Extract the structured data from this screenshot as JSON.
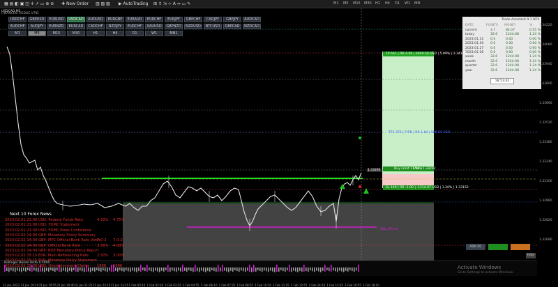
{
  "toolbar": {
    "new_order": "New Order",
    "auto_trading": "AutoTrading",
    "timeframes": [
      "M1",
      "M5",
      "M15",
      "M30",
      "H1",
      "H4",
      "D1",
      "W1",
      "MN"
    ]
  },
  "chart": {
    "symbol_title": "USDCAD,M5",
    "subtitle": "FINANCIAL HEDGE VTID",
    "symbols_row1": [
      "USDCHF",
      "GBPUSD",
      "EURUSD",
      "USDCAD",
      "AUDUSD",
      "EURGBP",
      "EURAUD",
      "EURCHF",
      "EURJPY",
      "GBPCHF",
      "CADJPY",
      "GBPJPY",
      "AUDCAD"
    ],
    "symbols_row2": [
      "AUDCHF",
      "AUDJPY",
      "EURNZD",
      "EURCAD",
      "CADCHF",
      "NZDJPY",
      "EURCHF",
      "XAUUSD",
      "GBPNZD",
      "NZDUSD",
      "BTCUSD",
      "GBPCAD",
      "NZDCAD"
    ],
    "periods": [
      "M1",
      "M5",
      "M15",
      "M30",
      "H1",
      "H4",
      "D1",
      "W1",
      "MN1"
    ],
    "active_symbol": "USDCAD",
    "active_period": "M5",
    "price_axis": [
      "1.34220",
      "1.34080",
      "1.33940",
      "1.33800",
      "1.33660",
      "1.33520",
      "1.33380",
      "1.33240",
      "1.33100",
      "1.32960",
      "1.32820",
      "1.32680"
    ],
    "time_axis": [
      "31 Jan 2023",
      "31 Jan 19:10",
      "31 Jan 19:55",
      "31 Jan 20:40",
      "31 Jan 21:25",
      "31 Jan 22:10",
      "31 Jan 23:25",
      "1 Feb 00:10",
      "1 Feb 02:10",
      "1 Feb 03:25",
      "1 Feb 04:55",
      "1 Feb 06:10",
      "1 Feb 07:25",
      "1 Feb 08:55",
      "1 Feb 10:10",
      "1 Feb 11:25",
      "1 Feb 12:55",
      "1 Feb 14:10",
      "1 Feb 15:25",
      "1 Feb 16:55",
      "1 Feb 18:10"
    ],
    "tp_label": "TP 641 | RR 4.99 | 6059.50 USD | 5.99% | 1.34133",
    "tp1_label": "TP1 373 | P RR | RR 1.84 | 589.59 USD",
    "entry_label": "Buy Limit 11.56 | 1.33292",
    "place_label": "Place",
    "sl_label": "SL 140 | RR -1.00 | -1214.07 USD | 1.20% | 1.33152",
    "sell_label": "SELL/PEvolt",
    "adr_label": "ADR D1",
    "bottom_buttons": [
      "Hide"
    ],
    "indicator": "Bollinger Bands Histo 0.5000",
    "watermark_title": "Activate Windows",
    "watermark_sub": "Go to Settings to activate Windows.",
    "price_tag": "1.33292"
  },
  "assistant": {
    "title": "Trade Assistant 9.1 NT4",
    "headers": [
      "DATE",
      "POINTS",
      "MONEY",
      "%"
    ],
    "rows": [
      [
        "current",
        "3.7",
        "84.07",
        "0.55 %"
      ],
      [
        "today",
        "32.6",
        "1244.08",
        "1.24 %"
      ],
      [
        "2023.01.31",
        "0.0",
        "0.00",
        "0.00 %"
      ],
      [
        "2023.01.30",
        "0.0",
        "0.00",
        "0.00 %"
      ],
      [
        "2023.01.27",
        "0.0",
        "0.00",
        "0.00 %"
      ],
      [
        "2023.01.26",
        "0.0",
        "0.00",
        "0.00 %"
      ],
      [
        "week",
        "32.6",
        "1244.08",
        "1.24 %"
      ],
      [
        "month",
        "32.6",
        "1244.08",
        "1.24 %"
      ],
      [
        "quarter",
        "32.6",
        "1244.08",
        "1.24 %"
      ],
      [
        "year",
        "32.6",
        "1244.08",
        "1.24 %"
      ]
    ],
    "time": "18:53:42"
  },
  "news": {
    "title": "Next 10 Forex News",
    "rows": [
      {
        "time": "2023.02.01 21:00",
        "text": "USD: Federal Funds Rate",
        "a": "4.50%",
        "b": "4.75%"
      },
      {
        "time": "2023.02.01 21:00",
        "text": "USD: FOMC Statement",
        "a": "",
        "b": ""
      },
      {
        "time": "2023.02.01 21:30",
        "text": "USD: FOMC Press Conference",
        "a": "",
        "b": ""
      },
      {
        "time": "2023.02.02 14:00",
        "text": "GBP: Monetary Policy Summary",
        "a": "",
        "b": ""
      },
      {
        "time": "2023.02.02 14:00",
        "text": "GBP: MPC Official Bank Rate Votes",
        "a": "7-0-2",
        "b": "7-0-2"
      },
      {
        "time": "2023.02.02 14:00",
        "text": "GBP: Official Bank Rate",
        "a": "3.50%",
        "b": "4.00%"
      },
      {
        "time": "2023.02.02 14:00",
        "text": "GBP: BOE Monetary Policy Report",
        "a": "",
        "b": ""
      },
      {
        "time": "2023.02.02 15:15",
        "text": "EUR: Main Refinancing Rate",
        "a": "2.50%",
        "b": "3.00%"
      },
      {
        "time": "2023.02.02 15:15",
        "text": "EUR: Monetary Policy Statement",
        "a": "",
        "b": ""
      },
      {
        "time": "2023.02.02 15:30",
        "text": "USD: Unemployment Claims",
        "a": "186K",
        "b": "196K"
      }
    ]
  },
  "colors": {
    "tp_zone": "#c8efc8",
    "sl_zone": "#f7c8c8",
    "tp_bar": "#1fa31f",
    "entry_bar": "#1f8f1f",
    "accent_magenta": "#d020d0",
    "green_line": "#20e020",
    "news_red": "#e03030"
  }
}
